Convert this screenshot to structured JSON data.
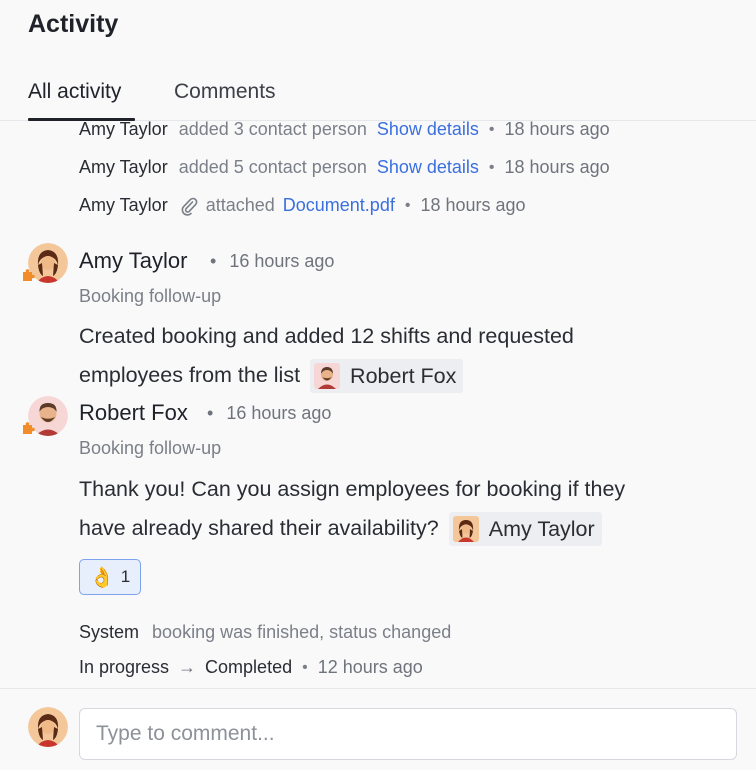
{
  "header": {
    "title": "Activity"
  },
  "tabs": [
    {
      "label": "All activity",
      "active": true
    },
    {
      "label": "Comments",
      "active": false
    }
  ],
  "compact_events": [
    {
      "actor": "Amy Taylor",
      "action": "added 3 contact person",
      "link": "Show details",
      "time": "18 hours ago"
    },
    {
      "actor": "Amy Taylor",
      "action": "added 5 contact person",
      "link": "Show details",
      "time": "18 hours ago"
    },
    {
      "actor": "Amy Taylor",
      "action": "attached",
      "icon": "paperclip-icon",
      "link": "Document.pdf",
      "time": "18 hours ago"
    }
  ],
  "comments": [
    {
      "author": "Amy Taylor",
      "time": "16 hours ago",
      "subtitle": "Booking follow-up",
      "body_line1": "Created booking and added 12 shifts and requested",
      "body_line2": "employees from the list",
      "mention": "Robert Fox",
      "badge_icon": "puzzle-icon"
    },
    {
      "author": "Robert Fox",
      "time": "16 hours ago",
      "subtitle": "Booking follow-up",
      "body_line1": "Thank you! Can you assign employees for booking if they",
      "body_line2": "have already shared their availability?",
      "mention": "Amy Taylor",
      "badge_icon": "puzzle-icon",
      "reaction": {
        "emoji": "👌",
        "count": "1"
      }
    }
  ],
  "system_event": {
    "actor": "System",
    "action": "booking was finished, status changed",
    "from_status": "In progress",
    "arrow": "→",
    "to_status": "Completed",
    "time": "12 hours ago"
  },
  "composer": {
    "placeholder": "Type to comment..."
  },
  "separator": "•",
  "colors": {
    "accent": "#3a6fe0",
    "reaction_bg": "#e7eefc",
    "reaction_border": "#7ea2ee"
  }
}
